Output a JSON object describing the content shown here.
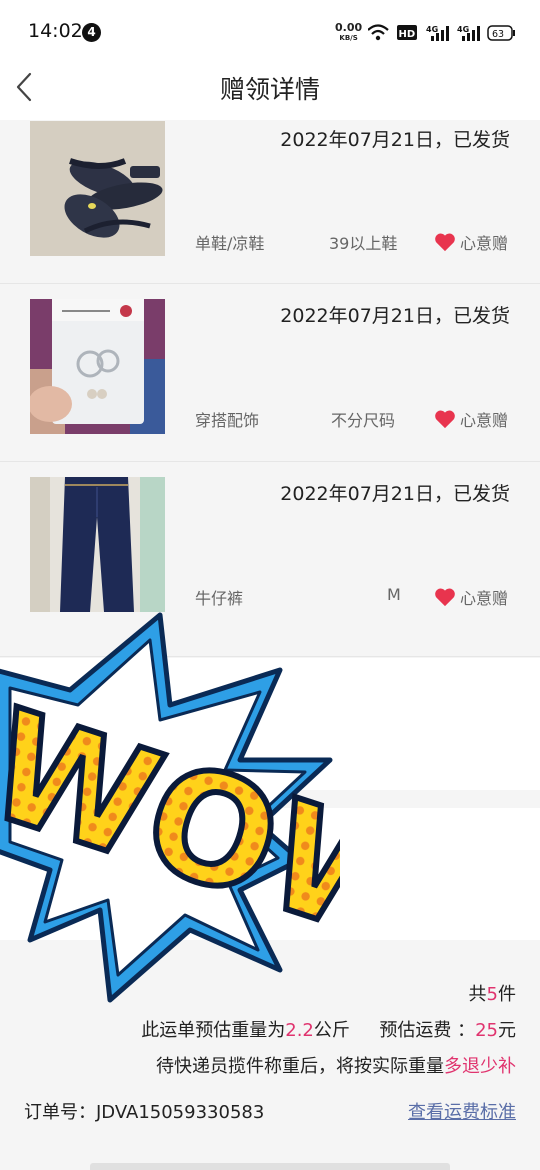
{
  "status_bar": {
    "time": "14:02",
    "notification_count": "4",
    "net_speed": "0.00",
    "net_unit": "KB/S",
    "battery": "63"
  },
  "nav": {
    "title": "赠领详情",
    "back_icon": "chevron-left-icon"
  },
  "items": [
    {
      "date_text": "2022年07月21日，已发货",
      "category": "单鞋/凉鞋",
      "size": "39以上鞋",
      "tag": "心意赠",
      "image": "sandals-photo"
    },
    {
      "date_text": "2022年07月21日，已发货",
      "category": "穿搭配饰",
      "size": "不分尺码",
      "tag": "心意赠",
      "image": "accessory-bag-photo"
    },
    {
      "date_text": "2022年07月21日，已发货",
      "category": "牛仔裤",
      "size": "M",
      "tag": "心意赠",
      "image": "jeans-photo"
    }
  ],
  "summary": {
    "count_prefix": "共",
    "count": "5",
    "count_suffix": "件",
    "weight_prefix": "此运单预估重量为",
    "weight": "2.2",
    "weight_unit": "公斤",
    "fee_label": "预估运费 ：",
    "fee": "25",
    "fee_unit": "元",
    "note_prefix": "待快递员揽件称重后，将按实际重量",
    "note_highlight": "多退少补",
    "order_label": "订单号：JDVA15059330583",
    "fee_link": "查看运费标准"
  },
  "sticker": {
    "text": "WOW!"
  },
  "colors": {
    "accent": "#e0336e",
    "link": "#5a6ea8",
    "heart": "#e8344e"
  }
}
